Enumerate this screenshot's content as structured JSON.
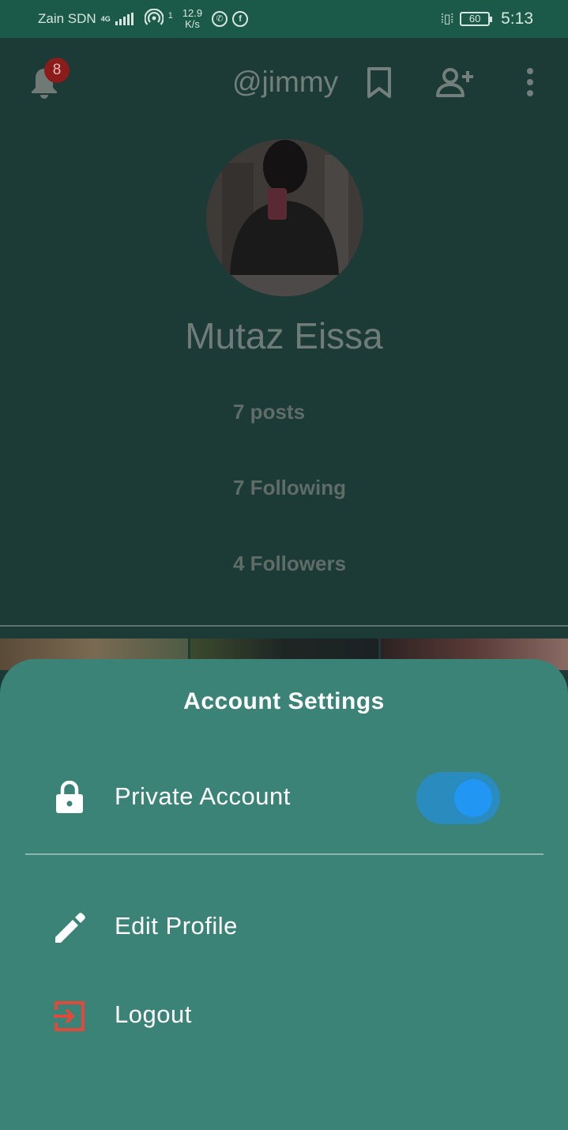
{
  "status_bar": {
    "carrier": "Zain SDN",
    "network": "4G",
    "speed_value": "12.9",
    "speed_unit": "K/s",
    "data_indicator": "1",
    "battery": "60",
    "time": "5:13",
    "icons": [
      "signal-icon",
      "hotspot-icon",
      "whatsapp-icon",
      "facebook-icon",
      "vibrate-icon",
      "battery-icon"
    ]
  },
  "header": {
    "notification_count": "8",
    "username": "@jimmy",
    "icons": [
      "bell-icon",
      "bookmark-icon",
      "add-person-icon",
      "more-vert-icon"
    ]
  },
  "profile": {
    "name": "Mutaz Eissa",
    "stats": {
      "posts": "7 posts",
      "following": "7 Following",
      "followers": "4 Followers"
    }
  },
  "sheet": {
    "title": "Account Settings",
    "items": [
      {
        "label": "Private Account",
        "icon": "lock-icon",
        "toggle_on": true
      },
      {
        "label": "Edit Profile",
        "icon": "pencil-icon"
      },
      {
        "label": "Logout",
        "icon": "logout-icon",
        "icon_color": "#e04a3b"
      }
    ]
  },
  "colors": {
    "status_bar": "#1b5a48",
    "background": "#1c3b36",
    "sheet": "#3b8376",
    "toggle_thumb": "#2196f3",
    "badge": "#8a1c1c"
  }
}
